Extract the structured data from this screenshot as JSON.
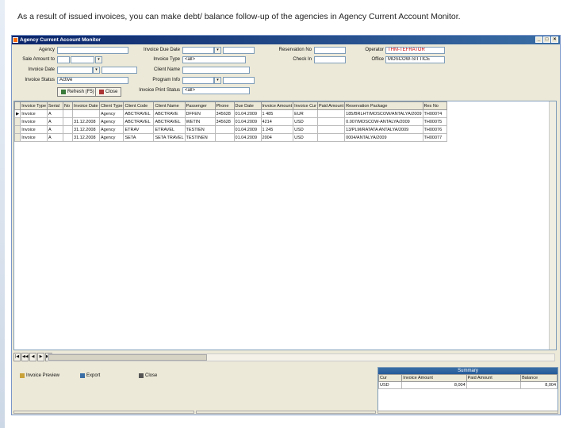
{
  "caption": "As a result of issued invoices, you can make debt/ balance follow-up of the agencies in Agency Current Account Monitor.",
  "window": {
    "title": "Agency Current Account Monitor",
    "min": "_",
    "max": "□",
    "close": "×"
  },
  "filters": {
    "agency_label": "Agency",
    "agency_value": "",
    "sales_agent_label": "Sale Amount to",
    "sales_agent_value": "",
    "invoice_date_label": "Invoice Date",
    "invoice_date_value": "",
    "status_label": "Invoice Status",
    "status_value": "Active",
    "due_date_label": "Invoice Due Date",
    "due_date_value": "",
    "invoice_type_label": "Invoice Type",
    "invoice_type_value": "<all>",
    "client_name_label": "Client Name",
    "client_name_value": "",
    "program_label": "Program Info",
    "program_value": "",
    "print_status_label": "Invoice Print Status",
    "print_status_value": "<all>",
    "reservation_label": "Reservation No",
    "reservation_value": "",
    "check_in_label": "Check In",
    "check_in_value": "",
    "operator_label": "Operator",
    "operator_value": "THM-TEFRATOR",
    "office_label": "Office",
    "office_value": "MOSCOW-SITTICE"
  },
  "buttons": {
    "refresh": "Refresh (F5)",
    "close_top": "Close",
    "preview": "Invoice Preview",
    "export": "Export",
    "close": "Close"
  },
  "grid": {
    "columns": [
      "Invoice Type",
      "Serial",
      "No",
      "Invoice Date",
      "Client Type",
      "Client Code",
      "Client Name",
      "Passenger",
      "Phone",
      "Due Date",
      "Invoice Amount",
      "Invoice Cur",
      "Paid Amount",
      "Reservation Package",
      "Res No"
    ],
    "rows": [
      [
        "Invoice",
        "A",
        "",
        "",
        "Agency",
        "ABCTRAVEL",
        "ABCTRAVE",
        "DFFEN",
        "345628",
        "01.04.2009",
        "1 485",
        "EUR",
        "",
        "185/BRLHT/MOSCOW/ANTALYA/2009",
        "TH00074"
      ],
      [
        "Invoice",
        "A",
        "",
        "31.12.2008",
        "Agency",
        "ABCTRAVEL",
        "ABCTRAVEL",
        "WETIN",
        "345628",
        "01.04.2009",
        "4214",
        "USD",
        "",
        "0.007/MOSCOW-ANTALYA/2009",
        "TH00075"
      ],
      [
        "Invoice",
        "A",
        "",
        "31.12.2008",
        "Agency",
        "ETRAV",
        "ETRAVEL",
        "TESTIEN",
        "",
        "01.04.2009",
        "1 245",
        "USD",
        "",
        "13/PLM/RATATA ANTALYA/2009",
        "TH00076"
      ],
      [
        "Invoice",
        "A",
        "",
        "31.12.2008",
        "Agency",
        "SETA",
        "SETA TRAVEL",
        "TESTINEN",
        "",
        "01.04.2009",
        "2004",
        "USD",
        "",
        "0004/ANTALYA/2009",
        "TH00077"
      ]
    ]
  },
  "nav": [
    "|◀",
    "◀◀",
    "◀",
    "▶",
    "▶▶",
    "▶|",
    "+"
  ],
  "summary": {
    "title": "Summary",
    "columns": [
      "Cur",
      "Invoice Amount",
      "Paid Amount",
      "Balance"
    ],
    "rows": [
      [
        "USD",
        "8,004",
        "",
        "8,004"
      ]
    ]
  }
}
